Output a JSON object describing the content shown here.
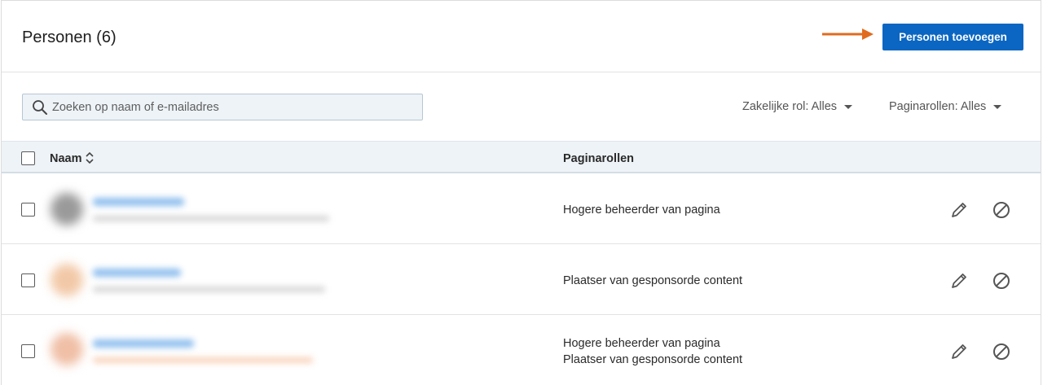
{
  "header": {
    "title": "Personen (6)",
    "add_button_label": "Personen toevoegen",
    "accent_color": "#0a66c2",
    "arrow_color": "#e06b1f"
  },
  "filters": {
    "search_placeholder": "Zoeken op naam of e-mailadres",
    "business_role": "Zakelijke rol: Alles",
    "page_roles": "Paginarollen: Alles"
  },
  "table": {
    "columns": {
      "name": "Naam",
      "page_roles": "Paginarollen"
    },
    "rows": [
      {
        "roles": [
          "Hogere beheerder van pagina"
        ]
      },
      {
        "roles": [
          "Plaatser van gesponsorde content"
        ]
      },
      {
        "roles": [
          "Hogere beheerder van pagina",
          "Plaatser van gesponsorde content"
        ]
      }
    ]
  },
  "icons": {
    "search": "search-icon",
    "sort": "sort-icon",
    "edit": "pencil-icon",
    "remove": "block-icon",
    "caret": "caret-down-icon"
  }
}
